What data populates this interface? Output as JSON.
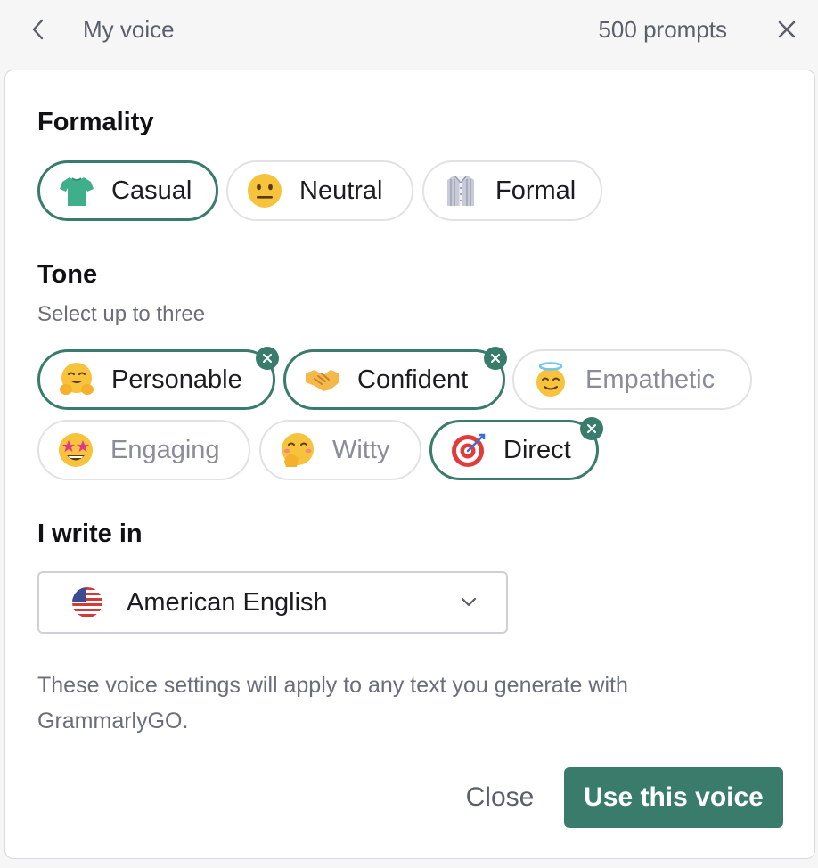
{
  "header": {
    "title": "My voice",
    "prompt_count": "500 prompts"
  },
  "formality": {
    "title": "Formality",
    "options": [
      {
        "label": "Casual",
        "icon": "t-shirt-icon",
        "selected": true
      },
      {
        "label": "Neutral",
        "icon": "neutral-face-icon",
        "selected": false
      },
      {
        "label": "Formal",
        "icon": "dress-shirt-icon",
        "selected": false
      }
    ]
  },
  "tone": {
    "title": "Tone",
    "subtitle": "Select up to three",
    "options": [
      {
        "label": "Personable",
        "icon": "hugging-face-icon",
        "selected": true
      },
      {
        "label": "Confident",
        "icon": "handshake-icon",
        "selected": true
      },
      {
        "label": "Empathetic",
        "icon": "halo-face-icon",
        "selected": false
      },
      {
        "label": "Engaging",
        "icon": "star-struck-face-icon",
        "selected": false
      },
      {
        "label": "Witty",
        "icon": "giggling-face-icon",
        "selected": false
      },
      {
        "label": "Direct",
        "icon": "bullseye-icon",
        "selected": true
      }
    ]
  },
  "language": {
    "title": "I write in",
    "selected": "American English",
    "flag_icon": "us-flag-icon"
  },
  "note": "These voice settings will apply to any text you generate with GrammarlyGO.",
  "actions": {
    "close_label": "Close",
    "use_label": "Use this voice"
  },
  "colors": {
    "accent": "#3a7c6b",
    "muted_text": "#6b6e7a",
    "border": "#e1e1e6"
  }
}
